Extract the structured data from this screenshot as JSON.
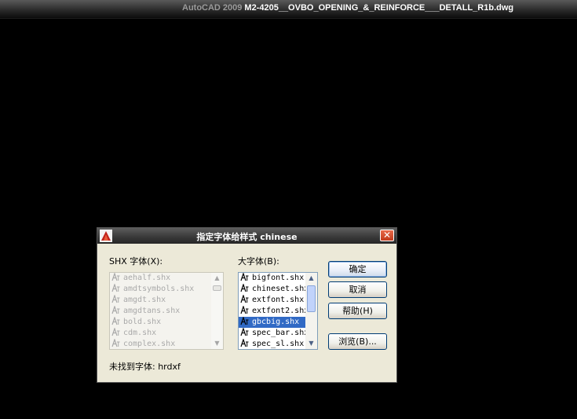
{
  "window": {
    "app_name": "AutoCAD 2009",
    "document_name": "M2-4205__OVBO_OPENING_&_REINFORCE___DETALL_R1b.dwg"
  },
  "dialog": {
    "title": "指定字体给样式 chinese",
    "close_label": "✕",
    "shx_label": "SHX 字体(X):",
    "big_label": "大字体(B):",
    "shx_fonts": [
      "aehalf.shx",
      "amdtsymbols.shx",
      "amgdt.shx",
      "amgdtans.shx",
      "bold.shx",
      "cdm.shx",
      "complex.shx"
    ],
    "big_fonts": [
      "bigfont.shx",
      "chineset.shx",
      "extfont.shx",
      "extfont2.shx",
      "gbcbig.shx",
      "spec_bar.shx",
      "spec_sl.shx"
    ],
    "selected_big_font": "gbcbig.shx",
    "status_text": "未找到字体: hrdxf",
    "buttons": {
      "ok": "确定",
      "cancel": "取消",
      "help": "帮助(H)",
      "browse": "浏览(B)..."
    }
  },
  "colors": {
    "desktop_bg": "#000000",
    "dialog_bg": "#ece9d8",
    "selection": "#316ac5"
  }
}
